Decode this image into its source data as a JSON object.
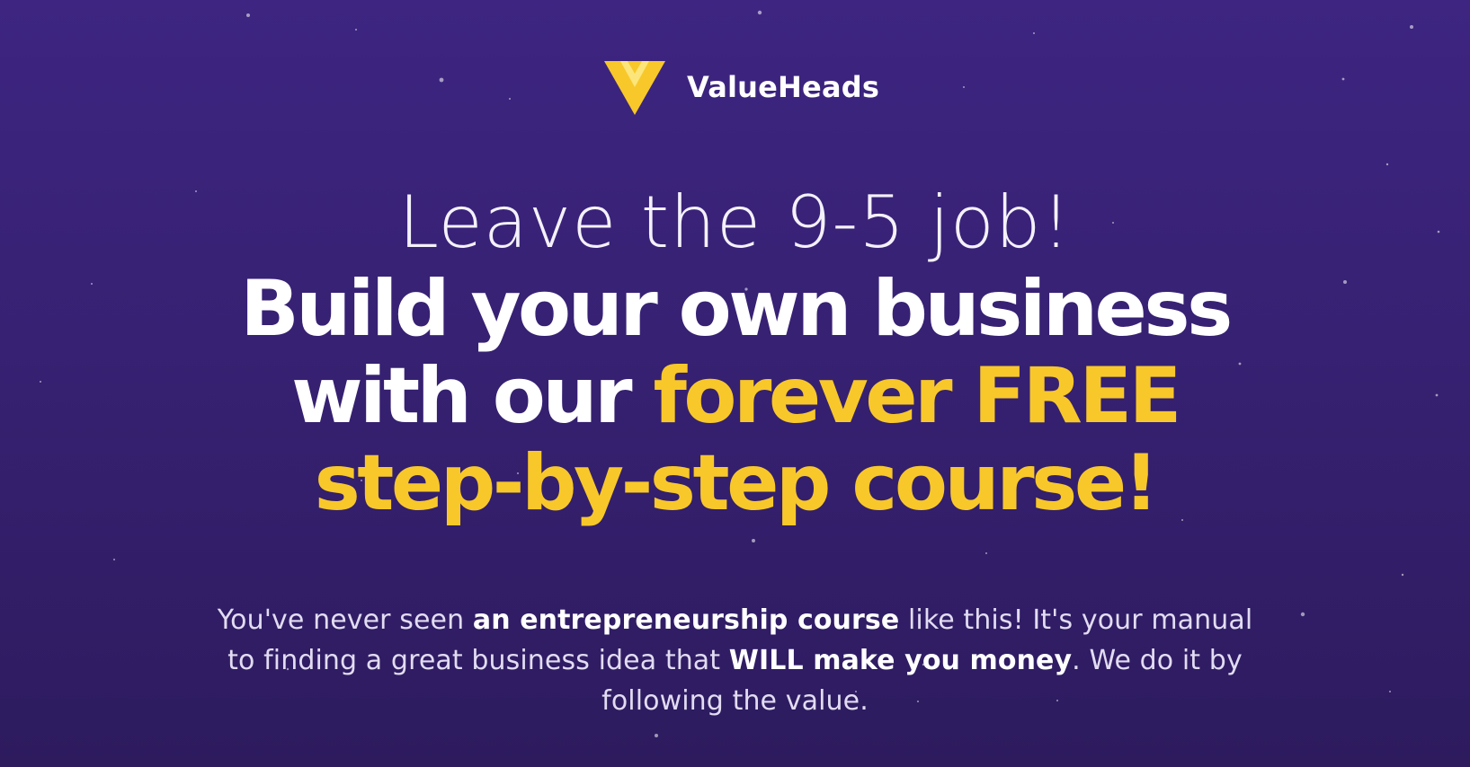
{
  "brand": {
    "name": "ValueHeads",
    "logo_icon": "v-chevron-logo-icon",
    "logo_color": "#f8c82a"
  },
  "headline": {
    "light_line": "Leave the 9-5 job!",
    "line1_white": "Build your own business",
    "line2_white": "with our ",
    "line2_yellow": "forever FREE",
    "line3_yellow": "step-by-step course!"
  },
  "subtitle": {
    "part1": "You've never seen ",
    "bold1": "an entrepreneurship course",
    "part2": " like this! It's your manual to finding a great business idea that ",
    "bold2": "WILL make you money",
    "part3": ". We do it by following the value."
  },
  "colors": {
    "background_top": "#3d2581",
    "background_bottom": "#2d1b5e",
    "accent_yellow": "#f8c82a",
    "text_white": "#ffffff"
  }
}
